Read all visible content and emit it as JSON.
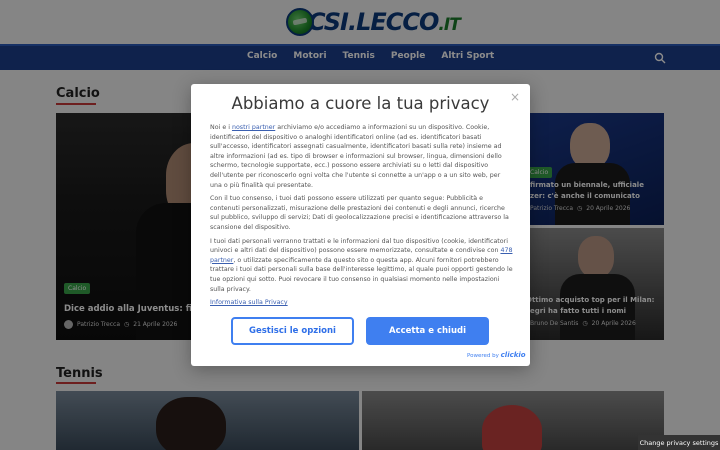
{
  "logo": {
    "text": "CSI.LECCO",
    "suffix": ".IT"
  },
  "nav": {
    "items": [
      "Calcio",
      "Motori",
      "Tennis",
      "People",
      "Altri Sport"
    ]
  },
  "sections": {
    "calcio": "Calcio",
    "tennis": "Tennis"
  },
  "articles": [
    {
      "badge": "Calcio",
      "title": "Dice addio alla Juventus: firm",
      "author": "Patrizio Trecca",
      "date": "21 Aprile 2026"
    },
    {
      "badge": "Calcio",
      "title": "firmato un biennale, ufficiale",
      "title2": "zer: c'è anche il comunicato",
      "author": "Patrizio Trecca",
      "date": "20 Aprile 2026"
    },
    {
      "title": "Ottimo acquisto top per il Milan:",
      "title2": "egri ha fatto tutti i nomi",
      "author": "Bruno De Santis",
      "date": "20 Aprile 2026"
    }
  ],
  "modal": {
    "title": "Abbiamo a cuore la tua privacy",
    "close": "×",
    "p1_a": "Noi e i ",
    "p1_link": "nostri partner",
    "p1_b": " archiviamo e/o accediamo a informazioni su un dispositivo. Cookie, identificatori del dispositivo o analoghi identificatori online (ad es. identificatori basati sull'accesso, identificatori assegnati casualmente, identificatori basati sulla rete) insieme ad altre informazioni (ad es. tipo di browser e informazioni sul browser, lingua, dimensioni dello schermo, tecnologie supportate, ecc.) possono essere archiviati su o letti dal dispositivo dell'utente per riconoscerlo ogni volta che l'utente si connette a un'app o a un sito web, per una o più finalità qui presentate.",
    "p2": "Con il tuo consenso, i tuoi dati possono essere utilizzati per quanto segue: Pubblicità e contenuti personalizzati, misurazione delle prestazioni dei contenuti e degli annunci, ricerche sul pubblico, sviluppo di servizi; Dati di geolocalizzazione precisi e identificazione attraverso la scansione del dispositivo.",
    "p3_a": "I tuoi dati personali verranno trattati e le informazioni dal tuo dispositivo (cookie, identificatori univoci e altri dati del dispositivo) possono essere memorizzate, consultate e condivise con ",
    "p3_link": "478 partner",
    "p3_b": ", o utilizzate specificamente da questo sito o questa app. Alcuni fornitori potrebbero trattare i tuoi dati personali sulla base dell'interesse legittimo, al quale puoi opporti gestendo le tue opzioni qui sotto. Puoi revocare il tuo consenso in qualsiasi momento nelle impostazioni sulla privacy.",
    "policy_link": "Informativa sulla Privacy",
    "btn_manage": "Gestisci le opzioni",
    "btn_accept": "Accetta e chiudi",
    "powered_by": "Powered by",
    "powered_brand": "clickio"
  },
  "privacy_tab": "Change privacy settings",
  "colors": {
    "nav": "#1d3f8a",
    "accent": "#3f7ff0",
    "badge": "#3aa54a",
    "section_line": "#c63a3a"
  }
}
